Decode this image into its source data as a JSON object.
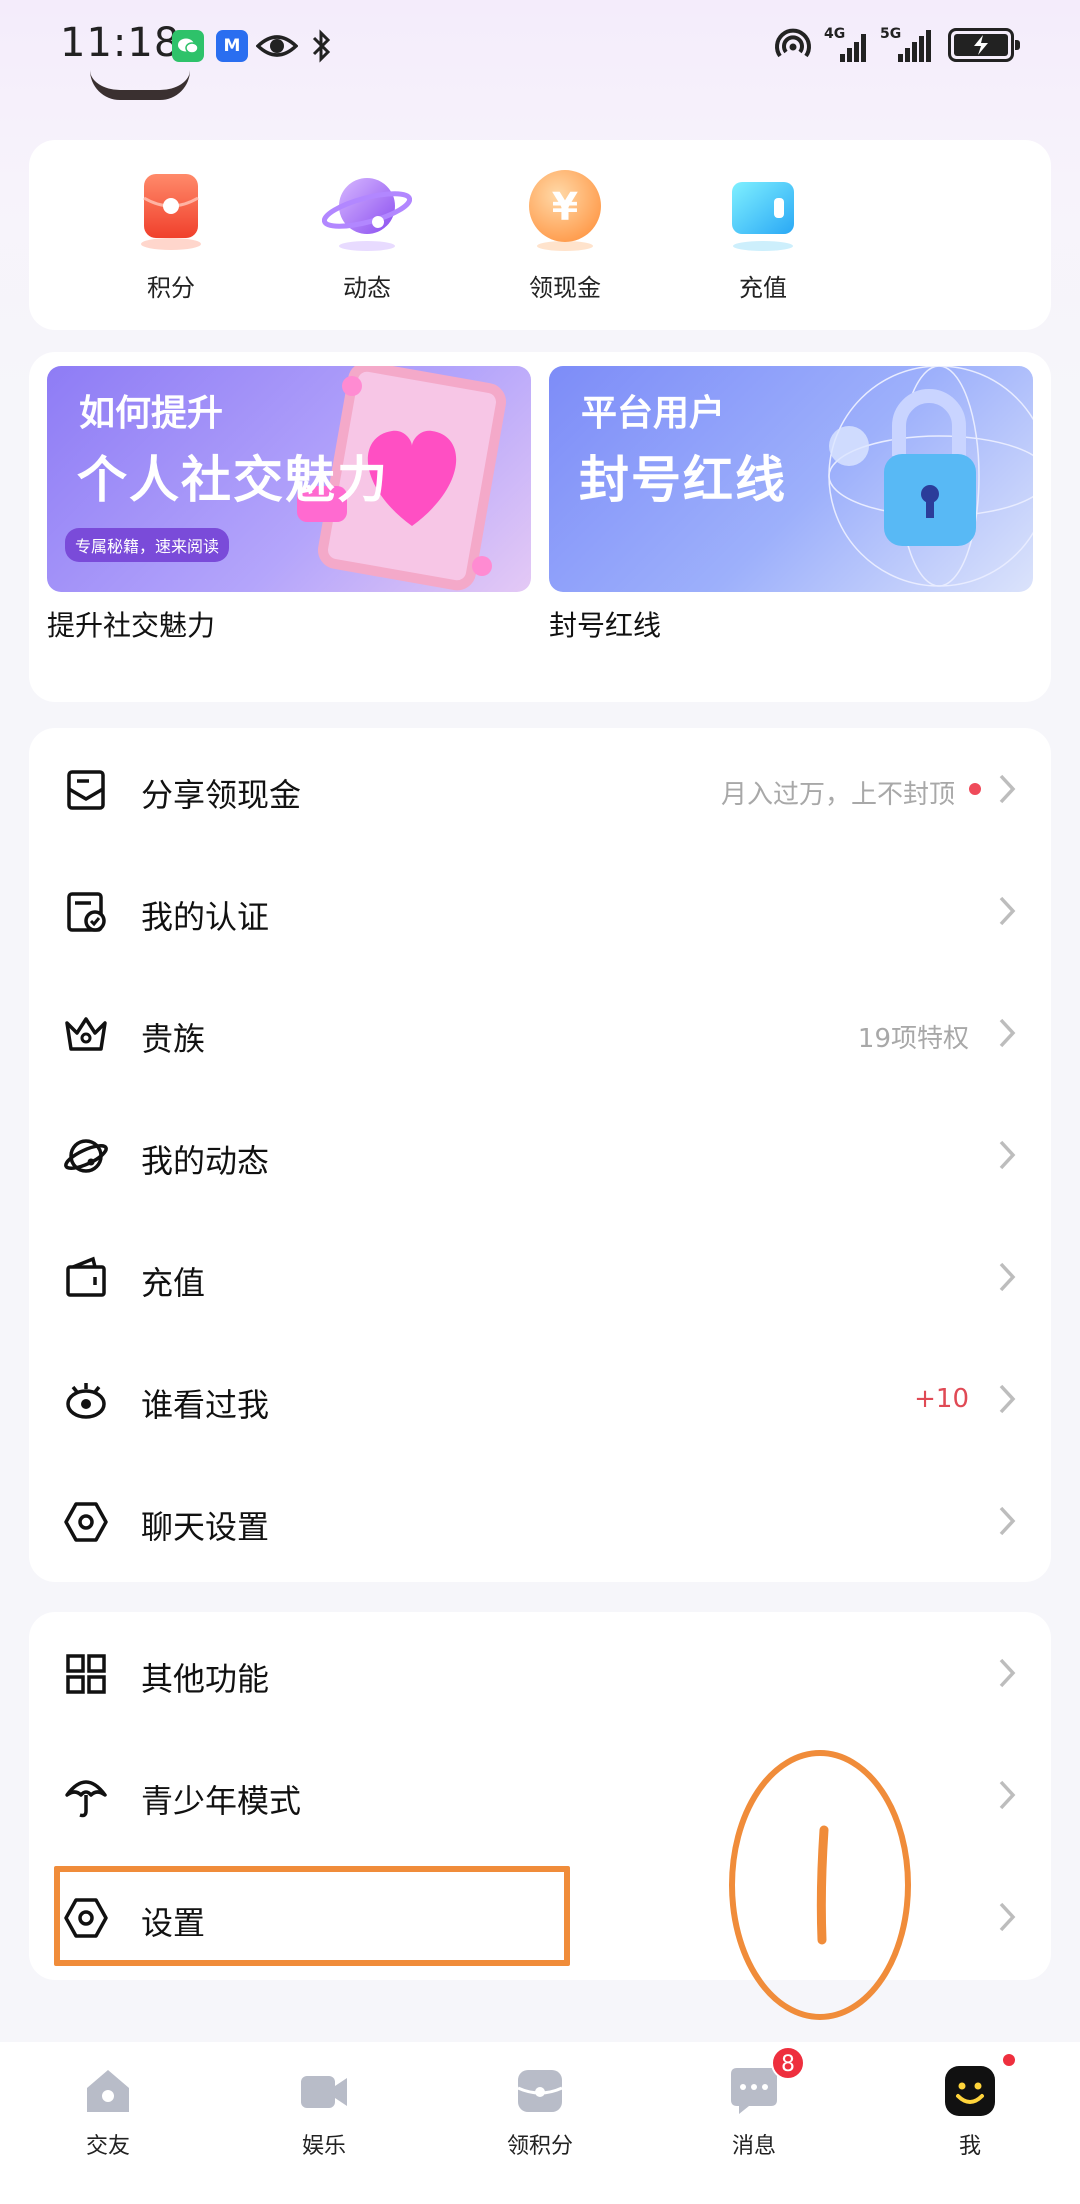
{
  "status_bar": {
    "time": "11:18",
    "network_1": "4G",
    "network_2": "5G",
    "app_badge_text": "M"
  },
  "quick_actions": [
    {
      "label": "积分",
      "icon": "red-envelope-icon"
    },
    {
      "label": "动态",
      "icon": "planet-icon"
    },
    {
      "label": "领现金",
      "icon": "yuan-coin-icon"
    },
    {
      "label": "充值",
      "icon": "wallet-icon"
    }
  ],
  "banners": [
    {
      "line1": "如何提升",
      "line2": "个人社交魅力",
      "tag": "专属秘籍，速来阅读",
      "caption": "提升社交魅力"
    },
    {
      "line1": "平台用户",
      "line2": "封号红线",
      "caption": "封号红线"
    }
  ],
  "menu": [
    {
      "label": "分享领现金",
      "icon": "share-envelope-icon",
      "value": "月入过万，上不封顶",
      "value_style": "gray",
      "dot": true
    },
    {
      "label": "我的认证",
      "icon": "certificate-icon",
      "value": ""
    },
    {
      "label": "贵族",
      "icon": "crown-icon",
      "value": "19项特权",
      "value_style": "gray"
    },
    {
      "label": "我的动态",
      "icon": "planet-outline-icon",
      "value": ""
    },
    {
      "label": "充值",
      "icon": "wallet-outline-icon",
      "value": ""
    },
    {
      "label": "谁看过我",
      "icon": "eye-icon",
      "value": "+10",
      "value_style": "red"
    },
    {
      "label": "聊天设置",
      "icon": "hexagon-settings-icon",
      "value": ""
    }
  ],
  "menu2": [
    {
      "label": "其他功能",
      "icon": "grid-icon"
    },
    {
      "label": "青少年模式",
      "icon": "umbrella-icon"
    },
    {
      "label": "设置",
      "icon": "settings-icon"
    }
  ],
  "bottom_nav": [
    {
      "label": "交友",
      "icon": "house-icon"
    },
    {
      "label": "娱乐",
      "icon": "video-camera-icon"
    },
    {
      "label": "领积分",
      "icon": "gift-box-icon"
    },
    {
      "label": "消息",
      "icon": "chat-bubble-icon",
      "badge": "8"
    },
    {
      "label": "我",
      "icon": "smile-face-icon",
      "active": true
    }
  ],
  "colors": {
    "accent_red": "#ee2f3e",
    "annotation_orange": "#f08c3a",
    "value_gray": "#a8a8a8"
  }
}
